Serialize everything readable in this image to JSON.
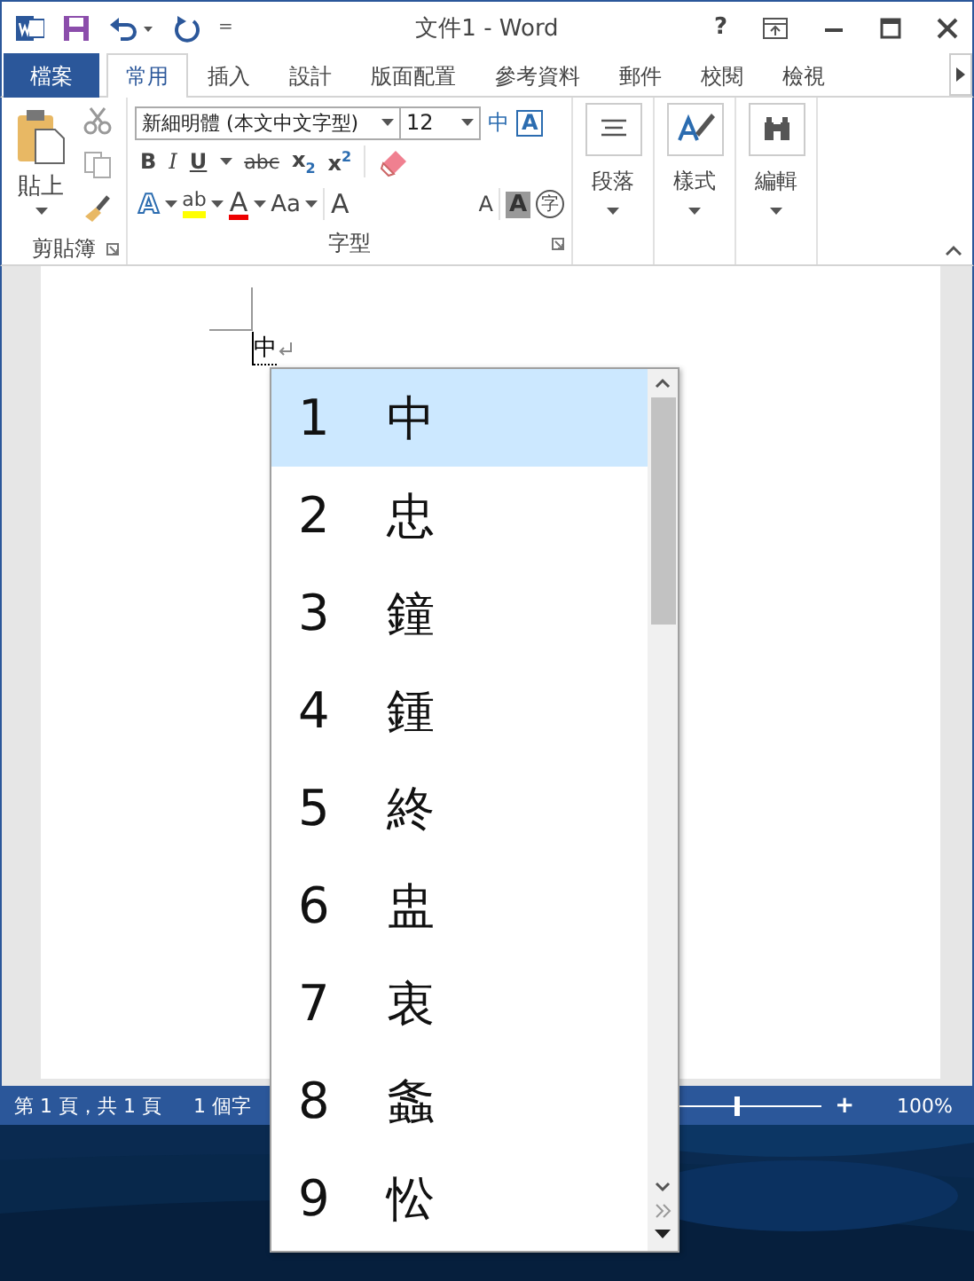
{
  "window": {
    "title": "文件1 - Word"
  },
  "quick_access": {
    "more": "="
  },
  "title_controls": {
    "help": "?"
  },
  "tabs": [
    {
      "label": "檔案",
      "kind": "file",
      "selected": false
    },
    {
      "label": "常用",
      "kind": "tab",
      "selected": true
    },
    {
      "label": "插入",
      "kind": "tab",
      "selected": false
    },
    {
      "label": "設計",
      "kind": "tab",
      "selected": false
    },
    {
      "label": "版面配置",
      "kind": "tab",
      "selected": false
    },
    {
      "label": "參考資料",
      "kind": "tab",
      "selected": false
    },
    {
      "label": "郵件",
      "kind": "tab",
      "selected": false
    },
    {
      "label": "校閱",
      "kind": "tab",
      "selected": false
    },
    {
      "label": "檢視",
      "kind": "tab",
      "selected": false
    }
  ],
  "ribbon": {
    "clipboard": {
      "paste": "貼上",
      "group": "剪貼簿"
    },
    "font": {
      "name": "新細明體 (本文中文字型)",
      "size": "12",
      "phonetic": "中",
      "border_letter": "A",
      "formats": [
        "B",
        "I",
        "U",
        "abc",
        "x$_{2}$",
        "x$^{2}$"
      ],
      "row3": [
        "A",
        "ab",
        "A",
        "Aa",
        "A",
        "A",
        "A",
        "字"
      ],
      "group": "字型"
    },
    "groups": [
      "段落",
      "樣式",
      "編輯"
    ]
  },
  "document": {
    "text": "中"
  },
  "candidates": [
    {
      "number": "1",
      "char": "中",
      "selected": true
    },
    {
      "number": "2",
      "char": "忠",
      "selected": false
    },
    {
      "number": "3",
      "char": "鐘",
      "selected": false
    },
    {
      "number": "4",
      "char": "鍾",
      "selected": false
    },
    {
      "number": "5",
      "char": "終",
      "selected": false
    },
    {
      "number": "6",
      "char": "盅",
      "selected": false
    },
    {
      "number": "7",
      "char": "衷",
      "selected": false
    },
    {
      "number": "8",
      "char": "螽",
      "selected": false
    },
    {
      "number": "9",
      "char": "忪",
      "selected": false
    }
  ],
  "status_bar": {
    "page": "第 1 頁，共 1 頁",
    "words": "1 個字",
    "zoom_plus": "+",
    "zoom": "100%",
    "zoom_slider": {
      "level": 0.5
    }
  }
}
